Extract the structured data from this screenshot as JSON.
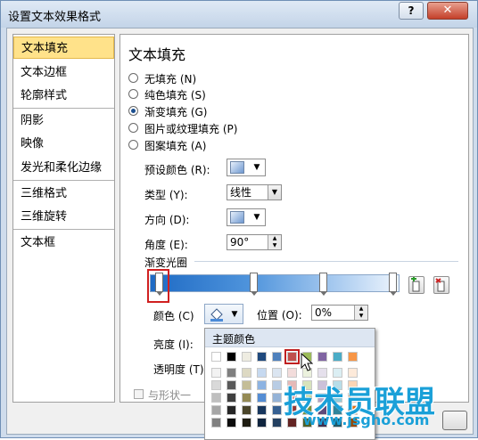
{
  "window": {
    "title": "设置文本效果格式",
    "help": "?",
    "close": "✕"
  },
  "sidebar": {
    "items": [
      {
        "label": "文本填充",
        "selected": true
      },
      {
        "label": "文本边框"
      },
      {
        "label": "轮廓样式"
      },
      {
        "label": "阴影"
      },
      {
        "label": "映像"
      },
      {
        "label": "发光和柔化边缘"
      },
      {
        "label": "三维格式"
      },
      {
        "label": "三维旋转"
      },
      {
        "label": "文本框"
      }
    ]
  },
  "panel": {
    "heading": "文本填充",
    "options": [
      {
        "label": "无填充 (N)"
      },
      {
        "label": "纯色填充 (S)"
      },
      {
        "label": "渐变填充 (G)",
        "checked": true
      },
      {
        "label": "图片或纹理填充 (P)"
      },
      {
        "label": "图案填充 (A)"
      }
    ],
    "preset_label": "预设颜色 (R):",
    "type_label": "类型 (Y):",
    "type_value": "线性",
    "direction_label": "方向 (D):",
    "angle_label": "角度 (E):",
    "angle_value": "90°",
    "stops_label": "渐变光圈",
    "color_label": "颜色 (C)",
    "position_label": "位置 (O):",
    "position_value": "0%",
    "brightness_label": "亮度 (I):",
    "transparency_label": "透明度 (T)",
    "rotate_label": "与形状一"
  },
  "palette": {
    "title": "主题颜色",
    "theme_row": [
      "#ffffff",
      "#000000",
      "#eeece1",
      "#1f497d",
      "#4f81bd",
      "#c0504d",
      "#9bbb59",
      "#8064a2",
      "#4bacc6",
      "#f79646"
    ],
    "selected_index": 5,
    "shade_columns": [
      [
        "#f2f2f2",
        "#d9d9d9",
        "#bfbfbf",
        "#a6a6a6",
        "#808080"
      ],
      [
        "#7f7f7f",
        "#595959",
        "#3f3f3f",
        "#262626",
        "#0c0c0c"
      ],
      [
        "#ddd9c3",
        "#c4bd97",
        "#948a54",
        "#4a452a",
        "#1e1c11"
      ],
      [
        "#c6d9f0",
        "#8db3e2",
        "#548dd4",
        "#17365d",
        "#0f243e"
      ],
      [
        "#dbe5f1",
        "#b8cce4",
        "#95b3d7",
        "#366092",
        "#244061"
      ],
      [
        "#f2dcdb",
        "#e5b9b7",
        "#d99694",
        "#953734",
        "#632423"
      ],
      [
        "#ebf1dd",
        "#d7e3bc",
        "#c3d69b",
        "#76923c",
        "#4f6128"
      ],
      [
        "#e5e0ec",
        "#ccc1d9",
        "#b2a2c7",
        "#5f497a",
        "#3f3151"
      ],
      [
        "#dbeef3",
        "#b7dde8",
        "#92cddc",
        "#31859b",
        "#205867"
      ],
      [
        "#fdeada",
        "#fbd5b5",
        "#fac08f",
        "#e36c09",
        "#974806"
      ]
    ]
  },
  "watermark": {
    "brand": "技术员联盟",
    "url": "www.jsgho.com",
    "color": "#1aa0d8"
  },
  "colors": {
    "accent_selected": "#ffe28a",
    "highlight_red": "#d02020"
  }
}
